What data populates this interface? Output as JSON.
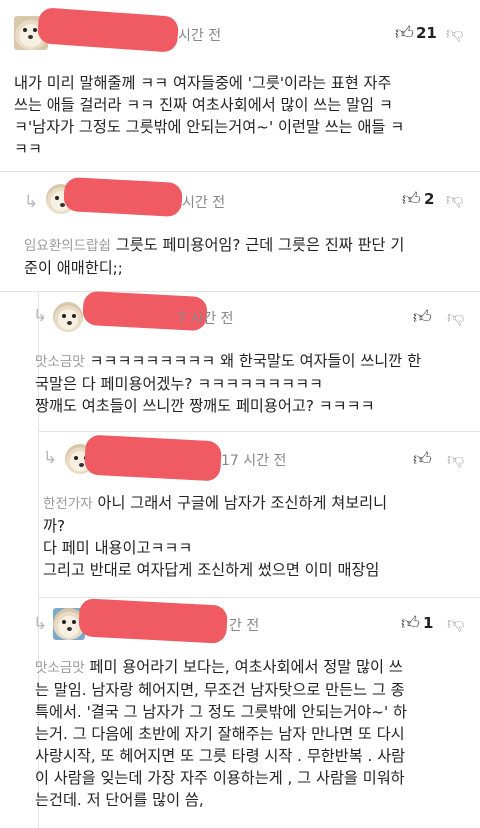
{
  "comments": [
    {
      "time": "시간 전",
      "up_icon": "thumb-up-icon",
      "likes": "21",
      "down_icon": "thumb-down-icon",
      "lines": [
        "내가 미리 말해줄께 ㅋㅋ 여자들중에 '그릇'이라는 표현 자주",
        "쓰는 애들 걸러라 ㅋㅋ 진짜 여초사회에서 많이 쓰는 말임 ㅋ",
        "ㅋ'남자가 그정도 그릇밖에 안되는거여~' 이런말 쓰는 애들 ㅋ",
        "ㅋㅋ"
      ]
    },
    {
      "time": "시간 전",
      "likes": "2",
      "nickname": "임요환의드랍쉽",
      "lines": [
        "그릇도 페미용어임? 근데 그릇은 진짜 판단 기",
        "준이 애매한디;;"
      ]
    },
    {
      "time": "7 시간 전",
      "nickname": "맛소금맛",
      "lines": [
        "ㅋㅋㅋㅋㅋㅋㅋㅋㅋ 왜 한국말도 여자들이 쓰니깐 한",
        "국말은 다 페미용어겠누? ㅋㅋㅋㅋㅋㅋㅋㅋㅋ",
        "짱깨도 여초들이 쓰니깐 짱깨도 페미용어고? ㅋㅋㅋㅋ"
      ]
    },
    {
      "time": "17 시간 전",
      "nickname": "한전가자",
      "lines": [
        "아니 그래서 구글에 남자가 조신하게 쳐보리니",
        "까?",
        "다 페미 내용이고ㅋㅋㅋ",
        "그리고 반대로 여자답게 조신하게 썼으면 이미 매장임"
      ]
    },
    {
      "time": "간 전",
      "likes": "1",
      "nickname": "맛소금맛",
      "lines": [
        "페미 용어라기 보다는, 여초사회에서 정말 많이 쓰",
        "는 말임. 남자랑 헤어지면, 무조건 남자탓으로 만든느 그 종",
        "특에서. '결국 그 남자가 그 정도 그릇밖에 안되는거야~' 하",
        "는거. 그 다음에 초반에 자기 잘해주는 남자 만나면 또 다시",
        "사랑시작, 또 헤어지면 또 그릇 타령 시작 . 무한반복 . 사람",
        "이 사람을 잊는데 가장 자주 이용하는게 , 그 사람을 미워하",
        "는건데. 저 단어를 많이 씀,"
      ]
    }
  ],
  "icons": {
    "reply": "reply-arrow-icon",
    "thumb_up": "thumb-up-icon",
    "thumb_down": "thumb-down-icon"
  },
  "colors": {
    "redaction": "#ef5a63"
  }
}
